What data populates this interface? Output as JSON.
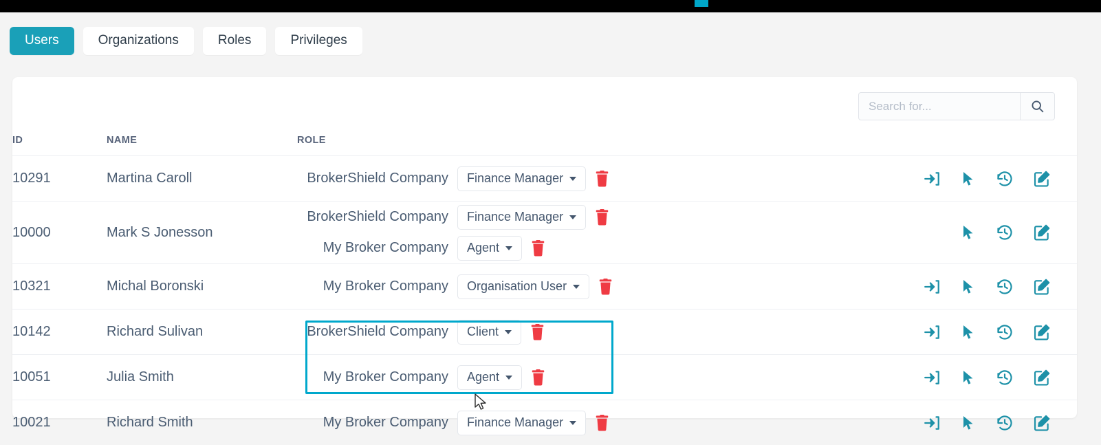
{
  "topbar": {
    "accent_color": "#00a7c9"
  },
  "tabs": [
    {
      "label": "Users",
      "active": true
    },
    {
      "label": "Organizations",
      "active": false
    },
    {
      "label": "Roles",
      "active": false
    },
    {
      "label": "Privileges",
      "active": false
    }
  ],
  "search": {
    "value": "",
    "placeholder": "Search for...",
    "button_icon": "search-icon"
  },
  "table": {
    "headers": {
      "id": "ID",
      "name": "NAME",
      "role": "ROLE",
      "actions": ""
    },
    "rows": [
      {
        "id": "10291",
        "name": "Martina Caroll",
        "roles": [
          {
            "org": "BrokerShield Company",
            "role": "Finance Manager"
          }
        ],
        "actions": [
          "login-icon",
          "impersonate-icon",
          "history-icon",
          "edit-icon"
        ]
      },
      {
        "id": "10000",
        "name": "Mark S Jonesson",
        "roles": [
          {
            "org": "BrokerShield Company",
            "role": "Finance Manager"
          },
          {
            "org": "My Broker Company",
            "role": "Agent"
          }
        ],
        "actions": [
          "impersonate-icon",
          "history-icon",
          "edit-icon"
        ]
      },
      {
        "id": "10321",
        "name": "Michal Boronski",
        "roles": [
          {
            "org": "My Broker Company",
            "role": "Organisation User"
          }
        ],
        "actions": [
          "login-icon",
          "impersonate-icon",
          "history-icon",
          "edit-icon"
        ]
      },
      {
        "id": "10142",
        "name": "Richard Sulivan",
        "roles": [
          {
            "org": "BrokerShield Company",
            "role": "Client"
          }
        ],
        "actions": [
          "login-icon",
          "impersonate-icon",
          "history-icon",
          "edit-icon"
        ]
      },
      {
        "id": "10051",
        "name": "Julia Smith",
        "roles": [
          {
            "org": "My Broker Company",
            "role": "Agent"
          }
        ],
        "actions": [
          "login-icon",
          "impersonate-icon",
          "history-icon",
          "edit-icon"
        ]
      },
      {
        "id": "10021",
        "name": "Richard Smith",
        "roles": [
          {
            "org": "My Broker Company",
            "role": "Finance Manager"
          }
        ],
        "actions": [
          "login-icon",
          "impersonate-icon",
          "history-icon",
          "edit-icon"
        ]
      }
    ]
  },
  "colors": {
    "accent": "#1aa0b8",
    "highlight": "#00a8cc",
    "delete": "#ef3b43",
    "icon": "#1d91a8"
  },
  "annotation": {
    "highlight_label": ""
  }
}
